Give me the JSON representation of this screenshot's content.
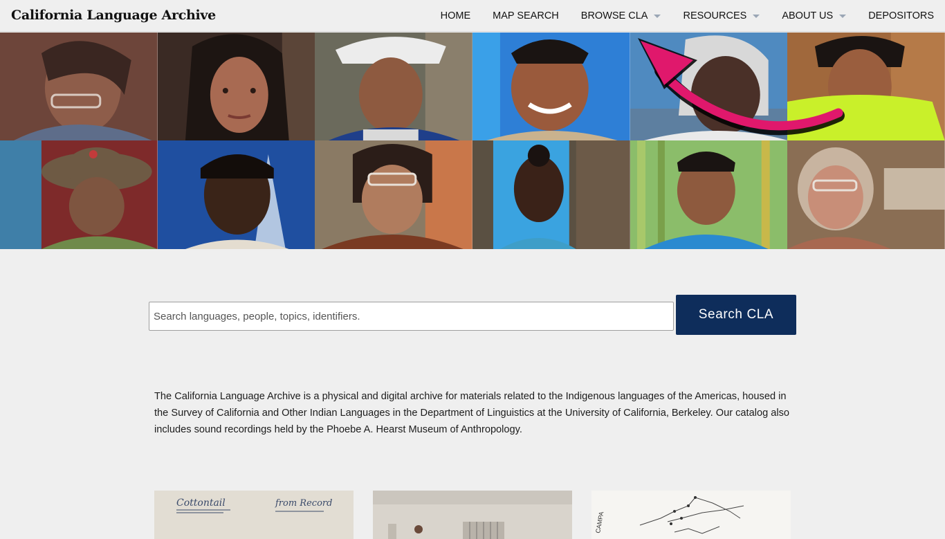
{
  "header": {
    "site_title": "California Language Archive",
    "nav": [
      {
        "label": "HOME",
        "dropdown": false
      },
      {
        "label": "MAP SEARCH",
        "dropdown": false
      },
      {
        "label": "BROWSE CLA",
        "dropdown": true
      },
      {
        "label": "RESOURCES",
        "dropdown": true
      },
      {
        "label": "ABOUT US",
        "dropdown": true
      },
      {
        "label": "DEPOSITORS",
        "dropdown": false
      }
    ]
  },
  "search": {
    "placeholder": "Search languages, people, topics, identifiers.",
    "value": "",
    "button_label": "Search CLA",
    "button_color": "#0e2d5b"
  },
  "intro": {
    "text": "The California Language Archive is a physical and digital archive for materials related to the Indigenous languages of the Americas, housed in the Survey of California and Other Indian Languages in the Department of Linguistics at the University of California, Berkeley. Our catalog also includes sound recordings held by the Phoebe A. Hearst Museum of Anthropology."
  },
  "cards": [
    {
      "handwriting_1": "Cottontail",
      "handwriting_2": "from Record"
    },
    {
      "icon": "classroom-photo"
    },
    {
      "map_label": "CAMPA"
    }
  ],
  "annotation": {
    "arrow_color": "#e0186c"
  }
}
